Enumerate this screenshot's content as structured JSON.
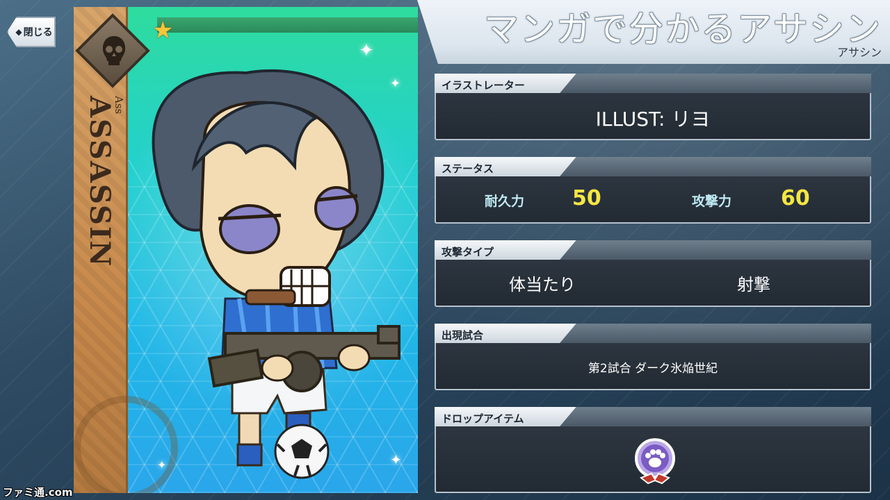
{
  "header": {
    "title": "マンガで分かるアサシン",
    "subtitle": "アサシン",
    "close_label": "閉じる"
  },
  "card": {
    "class_name": "ASSASSIN",
    "class_name_small": "Ass",
    "rarity_stars": 1,
    "star_color": "#f7c63a"
  },
  "panels": {
    "illustrator": {
      "label": "イラストレーター",
      "value": "ILLUST: リヨ"
    },
    "status": {
      "label": "ステータス",
      "endurance_label": "耐久力",
      "endurance_value": "50",
      "attack_label": "攻撃力",
      "attack_value": "60"
    },
    "attack_type": {
      "label": "攻撃タイプ",
      "type1": "体当たり",
      "type2": "射撃"
    },
    "appearance": {
      "label": "出現試合",
      "value": "第2試合 ダーク氷焔世紀"
    },
    "drop_item": {
      "label": "ドロップアイテム",
      "icon": "paw-emblem-icon"
    }
  },
  "watermark": "ファミ通.com",
  "colors": {
    "stat_value": "#f5e642",
    "stat_label": "#bfe9f3",
    "panel_bg": "#2a323c"
  }
}
